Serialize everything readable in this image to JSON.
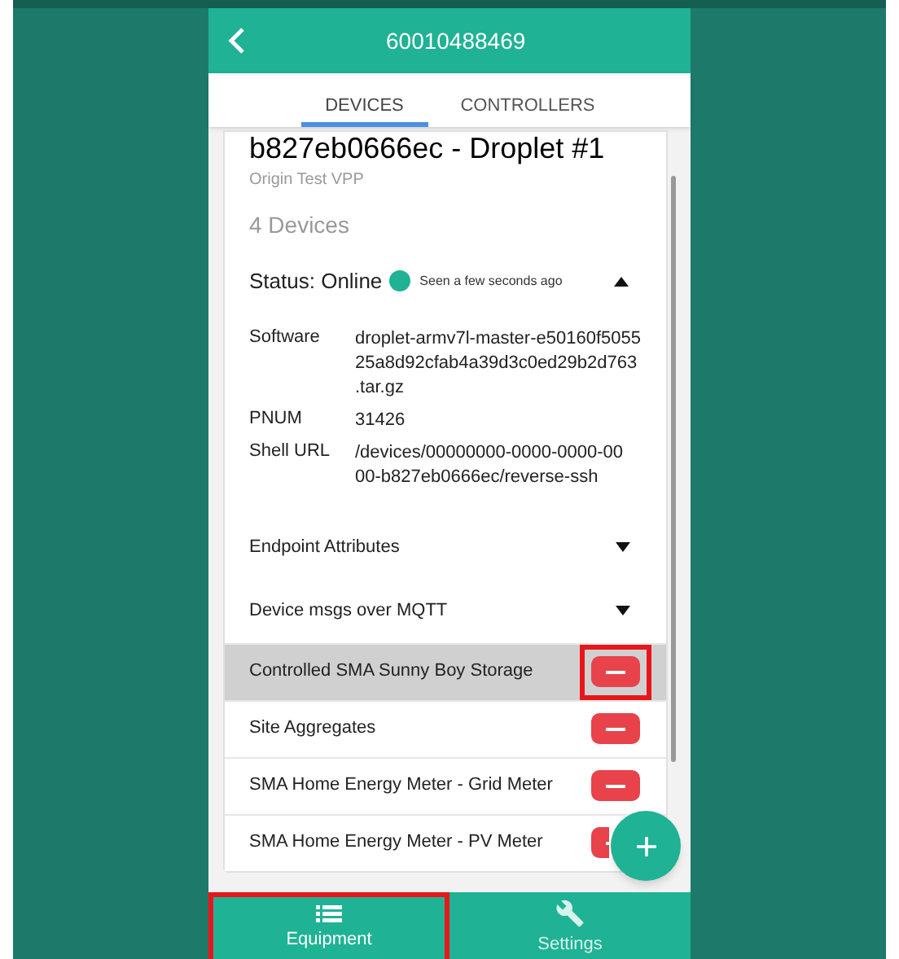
{
  "header": {
    "title": "60010488469"
  },
  "tabs": [
    {
      "label": "DEVICES",
      "selected": true
    },
    {
      "label": "CONTROLLERS",
      "selected": false
    }
  ],
  "device": {
    "title": "b827eb0666ec - Droplet #1",
    "subtitle": "Origin Test VPP",
    "count": "4 Devices",
    "status": {
      "label": "Status: Online",
      "online": true,
      "seen": "Seen a few seconds ago",
      "expanded": true
    },
    "details": [
      {
        "label": "Software",
        "value_lines": [
          "droplet-armv7l-master-e50160f5055",
          "25a8d92cfab4a39d3c0ed29b2d763",
          ".tar.gz"
        ]
      },
      {
        "label": "PNUM",
        "value_lines": [
          "31426"
        ]
      },
      {
        "label": "Shell URL",
        "value_lines": [
          "/devices/00000000-0000-0000-00",
          "00-b827eb0666ec/reverse-ssh"
        ]
      }
    ],
    "sections": [
      {
        "label": "Endpoint Attributes",
        "expanded": false
      },
      {
        "label": "Device msgs over MQTT",
        "expanded": false
      }
    ]
  },
  "equipment": [
    {
      "name": "Controlled SMA Sunny Boy Storage",
      "selected": true,
      "annotated": true
    },
    {
      "name": "Site Aggregates",
      "selected": false,
      "annotated": false
    },
    {
      "name": "SMA Home Energy Meter - Grid Meter",
      "selected": false,
      "annotated": false
    },
    {
      "name": "SMA Home Energy Meter - PV Meter",
      "selected": false,
      "annotated": false
    }
  ],
  "bottom_nav": [
    {
      "label": "Equipment",
      "kind": "list",
      "selected": true,
      "annotated": true
    },
    {
      "label": "Settings",
      "kind": "wrench",
      "selected": false,
      "annotated": false
    }
  ]
}
